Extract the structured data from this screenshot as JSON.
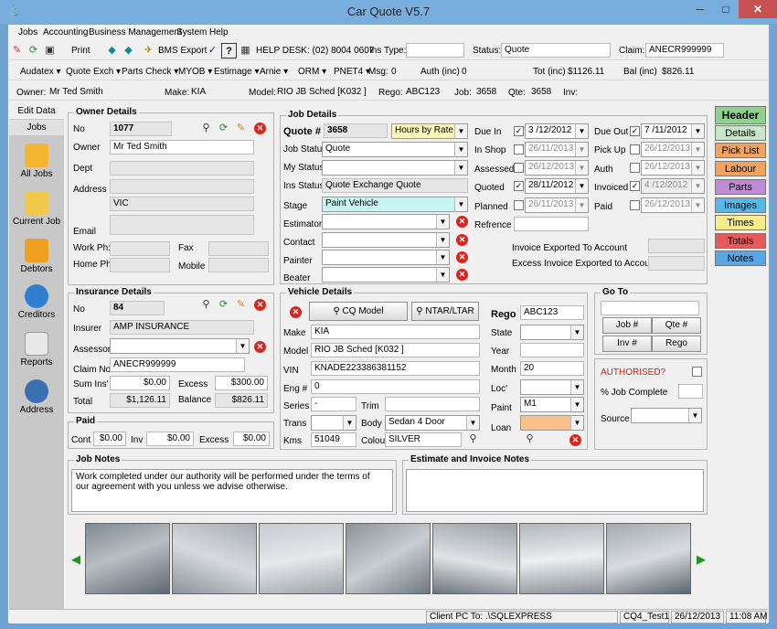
{
  "window": {
    "title": "Car Quote V5.7",
    "minimize": "─",
    "maximize": "□",
    "close": "✕"
  },
  "menu": [
    "Jobs",
    "Accounting",
    "Business Management",
    "System",
    "Help"
  ],
  "toolbar1": {
    "print": "Print",
    "bms_export": "BMS Export",
    "helpdesk": "HELP DESK: (02) 8004 0607",
    "ins_type_label": "Ins Type:",
    "ins_type_value": "",
    "status_label": "Status:",
    "status_value": "Quote",
    "claim_label": "Claim:",
    "claim_value": "ANECR999999"
  },
  "toolbar2": {
    "items": [
      "Audatex",
      "Quote Exch",
      "Parts Check",
      "MYOB",
      "Estimage",
      "Arnie",
      "ORM",
      "PNET4"
    ],
    "msg_label": "Msg:",
    "msg_value": "0",
    "auth_label": "Auth (inc)",
    "auth_value": "0",
    "tot_label": "Tot (inc)",
    "tot_value": "$1126.11",
    "bal_label": "Bal (inc)",
    "bal_value": "$826.11"
  },
  "infobar": {
    "owner_label": "Owner:",
    "owner_value": "Mr Ted Smith",
    "make_label": "Make:",
    "make_value": "KIA",
    "model_label": "Model:",
    "model_value": "RIO JB Sched [K032     ]",
    "rego_label": "Rego:",
    "rego_value": "ABC123",
    "job_label": "Job:",
    "job_value": "3658",
    "qte_label": "Qte:",
    "qte_value": "3658",
    "inv_label": "Inv:",
    "inv_value": ""
  },
  "leftnav": {
    "tabs": [
      "Edit Data",
      "Jobs"
    ],
    "items": [
      "All Jobs",
      "Current Job",
      "Debtors",
      "Creditors",
      "Reports",
      "Address"
    ]
  },
  "owner": {
    "title": "Owner Details",
    "no_label": "No",
    "no_value": "1077",
    "owner_label": "Owner",
    "owner_value": "Mr Ted Smith",
    "dept_label": "Dept",
    "address_label": "Address",
    "address_state": "VIC",
    "email_label": "Email",
    "workph_label": "Work Ph:",
    "fax_label": "Fax",
    "homeph_label": "Home Ph:",
    "mobile_label": "Mobile"
  },
  "insurance": {
    "title": "Insurance Details",
    "no_label": "No",
    "no_value": "84",
    "insurer_label": "Insurer",
    "insurer_value": "AMP INSURANCE",
    "assessor_label": "Assessor",
    "claim_label": "Claim No",
    "claim_value": "ANECR999999",
    "sumins_label": "Sum Ins'",
    "sumins_value": "$0.00",
    "excess_label": "Excess",
    "excess_value": "$300.00",
    "total_label": "Total",
    "total_value": "$1,126.11",
    "balance_label": "Balance",
    "balance_value": "$826.11"
  },
  "paid": {
    "title": "Paid",
    "cont_label": "Cont",
    "cont_value": "$0.00",
    "inv_label": "Inv",
    "inv_value": "$0.00",
    "excess_label": "Excess",
    "excess_value": "$0.00"
  },
  "job": {
    "title": "Job Details",
    "quote_label": "Quote #",
    "quote_value": "3658",
    "hours_mode": "Hours by Rate",
    "jobstatus_label": "Job Status",
    "jobstatus_value": "Quote",
    "mystatus_label": "My Status",
    "insstatus_label": "Ins Status",
    "insstatus_value": "Quote Exchange Quote",
    "stage_label": "Stage",
    "stage_value": "Paint Vehicle",
    "estimator_label": "Estimator",
    "contact_label": "Contact",
    "painter_label": "Painter",
    "beater_label": "Beater",
    "duein_label": "Due In",
    "duein_value": "3 /12/2012",
    "inshop_label": "In Shop",
    "inshop_value": "26/11/2013",
    "assessed_label": "Assessed",
    "assessed_value": "26/12/2013",
    "quoted_label": "Quoted",
    "quoted_value": "28/11/2012",
    "planned_label": "Planned",
    "planned_value": "26/11/2013",
    "refrence_label": "Refrence",
    "dueout_label": "Due Out",
    "dueout_value": "7 /11/2012",
    "pickup_label": "Pick Up",
    "pickup_value": "26/12/2013",
    "auth_label": "Auth",
    "auth_value": "26/12/2013",
    "invoiced_label": "Invoiced",
    "invoiced_value": "4 /12/2012",
    "paid_label": "Paid",
    "paid_value": "26/12/2013",
    "inv_exported": "Invoice Exported To Account",
    "excess_exported": "Excess Invoice Exported to Account"
  },
  "vehicle": {
    "title": "Vehicle Details",
    "cq_model": "CQ Model",
    "ntar": "NTAR/LTAR",
    "make_label": "Make",
    "make_value": "KIA",
    "model_label": "Model",
    "model_value": "RIO JB Sched [K032      ]",
    "vin_label": "VIN",
    "vin_value": "KNADE223386381152",
    "eng_label": "Eng #",
    "eng_value": "0",
    "series_label": "Series",
    "series_value": "-",
    "trim_label": "Trim",
    "trans_label": "Trans",
    "body_label": "Body",
    "body_value": "Sedan 4 Door",
    "kms_label": "Kms",
    "kms_value": "51049",
    "colour_label": "Colour",
    "colour_value": "SILVER",
    "rego_label": "Rego",
    "rego_value": "ABC123",
    "state_label": "State",
    "year_label": "Year",
    "month_label": "Month",
    "month_value": "20",
    "loc_label": "Loc'",
    "paint_label": "Paint",
    "paint_value": "M1",
    "loan_label": "Loan"
  },
  "goto": {
    "title": "Go To",
    "job": "Job #",
    "qte": "Qte #",
    "inv": "Inv #",
    "rego": "Rego"
  },
  "auth": {
    "authorised": "AUTHORISED?",
    "job_complete": "% Job Complete",
    "source": "Source"
  },
  "righttabs": [
    "Header",
    "Details",
    "Pick List",
    "Labour",
    "Parts",
    "Images",
    "Times",
    "Totals",
    "Notes"
  ],
  "righttab_colors": [
    "#8fd18f",
    "#c8e6c8",
    "#f5a35a",
    "#f5a35a",
    "#c08ad6",
    "#56b8e8",
    "#f6ec8a",
    "#e85a5a",
    "#56a8e8"
  ],
  "notes": {
    "job_title": "Job Notes",
    "job_text": "Work completed under our authority will be performed under the terms of our agreement with you unless we advise otherwise.",
    "estimate_title": "Estimate and Invoice Notes",
    "estimate_text": ""
  },
  "statusbar": {
    "client": "Client PC To: .\\SQLEXPRESS",
    "db": "CQ4_Test1",
    "date": "26/12/2013",
    "time": "11:08 AM"
  },
  "icons": {
    "binoculars": "binoculars-icon",
    "refresh": "refresh-icon",
    "edit": "pencil-icon",
    "delete": "delete-icon"
  }
}
